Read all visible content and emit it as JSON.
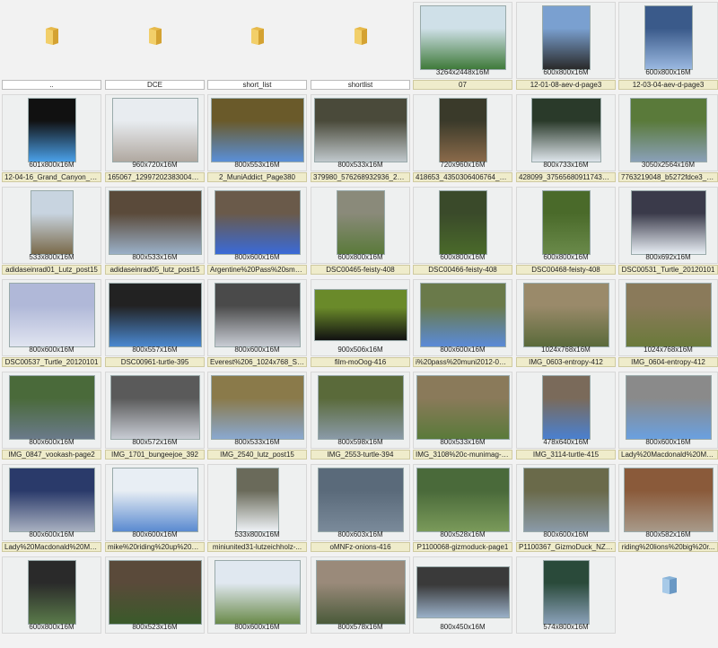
{
  "items": [
    {
      "type": "folder",
      "caption": "..",
      "res": ""
    },
    {
      "type": "folder",
      "caption": "DCE",
      "res": ""
    },
    {
      "type": "folder",
      "caption": "short_list",
      "res": ""
    },
    {
      "type": "folder",
      "caption": "shortlist",
      "res": ""
    },
    {
      "type": "image",
      "caption": "07",
      "res": "3264x2448x16M",
      "tw": 96,
      "th": 72,
      "c1": "#3f7a3a",
      "c2": "#cfe0e8"
    },
    {
      "type": "image",
      "caption": "12-01-08-aev-d-page3",
      "res": "600x800x16M",
      "tw": 54,
      "th": 72,
      "c1": "#2a2a2a",
      "c2": "#7aa0d0"
    },
    {
      "type": "image",
      "caption": "12-03-04-aev-d-page3",
      "res": "600x800x16M",
      "tw": 54,
      "th": 72,
      "c1": "#9ab8e0",
      "c2": "#3a5a8a"
    },
    {
      "type": "image",
      "caption": "12-04-16_Grand_Canyon_A...",
      "res": "601x800x16M",
      "tw": 54,
      "th": 72,
      "c1": "#4aa0e8",
      "c2": "#111111"
    },
    {
      "type": "image",
      "caption": "165067_129972023830043_1...",
      "res": "960x720x16M",
      "tw": 96,
      "th": 72,
      "c1": "#b0a8a0",
      "c2": "#e8ecf0"
    },
    {
      "type": "image",
      "caption": "2_MuniAddict_Page380",
      "res": "800x553x16M",
      "tw": 104,
      "th": 72,
      "c1": "#5a8fd8",
      "c2": "#6a5a2a"
    },
    {
      "type": "image",
      "caption": "379980_576268932936_2655...",
      "res": "800x533x16M",
      "tw": 104,
      "th": 72,
      "c1": "#c0c8cc",
      "c2": "#4a4a3a"
    },
    {
      "type": "image",
      "caption": "418653_4350306406764_211...",
      "res": "720x960x16M",
      "tw": 54,
      "th": 72,
      "c1": "#8a6a4a",
      "c2": "#3a3a2a"
    },
    {
      "type": "image",
      "caption": "428099_375656809117435_1...",
      "res": "800x733x16M",
      "tw": 78,
      "th": 72,
      "c1": "#dde4ea",
      "c2": "#2a3a2a"
    },
    {
      "type": "image",
      "caption": "7763219048_b5272fdce3_o_...",
      "res": "3050x2564x16M",
      "tw": 86,
      "th": 72,
      "c1": "#8aa0b8",
      "c2": "#5a7a3a"
    },
    {
      "type": "image",
      "caption": "adidaseinrad01_Lutz_post15",
      "res": "533x800x16M",
      "tw": 48,
      "th": 72,
      "c1": "#7a6a4a",
      "c2": "#c8d4e0"
    },
    {
      "type": "image",
      "caption": "adidaseinrad05_lutz_post15",
      "res": "800x533x16M",
      "tw": 104,
      "th": 72,
      "c1": "#9ab0c8",
      "c2": "#5a4a3a"
    },
    {
      "type": "image",
      "caption": "Argentine%20Pass%20small...",
      "res": "800x600x16M",
      "tw": 96,
      "th": 72,
      "c1": "#3a6ad8",
      "c2": "#6a5a4a"
    },
    {
      "type": "image",
      "caption": "DSC00465-feisty-408",
      "res": "600x800x16M",
      "tw": 54,
      "th": 72,
      "c1": "#5a7a3a",
      "c2": "#8a8a7a"
    },
    {
      "type": "image",
      "caption": "DSC00466-feisty-408",
      "res": "600x800x16M",
      "tw": 54,
      "th": 72,
      "c1": "#4a6a2a",
      "c2": "#3a4a2a"
    },
    {
      "type": "image",
      "caption": "DSC00468-feisty-408",
      "res": "600x800x16M",
      "tw": 54,
      "th": 72,
      "c1": "#6a8a4a",
      "c2": "#4a6a2a"
    },
    {
      "type": "image",
      "caption": "DSC00531_Turtle_20120101",
      "res": "800x692x16M",
      "tw": 84,
      "th": 72,
      "c1": "#e8eef4",
      "c2": "#3a3a4a"
    },
    {
      "type": "image",
      "caption": "DSC00537_Turtle_20120101",
      "res": "800x600x16M",
      "tw": 96,
      "th": 72,
      "c1": "#e0e4f0",
      "c2": "#b0b8d8"
    },
    {
      "type": "image",
      "caption": "DSC00961-turtle-395",
      "res": "800x557x16M",
      "tw": 104,
      "th": 72,
      "c1": "#4a88d0",
      "c2": "#222222"
    },
    {
      "type": "image",
      "caption": "Everest%206_1024x768_Stev...",
      "res": "800x600x16M",
      "tw": 96,
      "th": 72,
      "c1": "#c8ccd4",
      "c2": "#4a4a4a"
    },
    {
      "type": "image",
      "caption": "film-moOog-416",
      "res": "900x506x16M",
      "tw": 104,
      "th": 58,
      "c1": "#111111",
      "c2": "#6a8a2a"
    },
    {
      "type": "image",
      "caption": "i%20pass%20muni2012-09-...",
      "res": "800x600x16M",
      "tw": 96,
      "th": 72,
      "c1": "#5a8ad8",
      "c2": "#6a7a4a"
    },
    {
      "type": "image",
      "caption": "IMG_0603-entropy-412",
      "res": "1024x768x16M",
      "tw": 96,
      "th": 72,
      "c1": "#5a6a3a",
      "c2": "#9a8a6a"
    },
    {
      "type": "image",
      "caption": "IMG_0604-entropy-412",
      "res": "1024x768x16M",
      "tw": 96,
      "th": 72,
      "c1": "#6a7a3a",
      "c2": "#8a7a5a"
    },
    {
      "type": "image",
      "caption": "IMG_0847_vookash-page2",
      "res": "800x600x16M",
      "tw": 96,
      "th": 72,
      "c1": "#6a7a8a",
      "c2": "#4a6a3a"
    },
    {
      "type": "image",
      "caption": "IMG_1701_bungeejoe_392",
      "res": "800x572x16M",
      "tw": 100,
      "th": 72,
      "c1": "#c8ccd4",
      "c2": "#5a5a5a"
    },
    {
      "type": "image",
      "caption": "IMG_2540_lutz_post15",
      "res": "800x533x16M",
      "tw": 104,
      "th": 72,
      "c1": "#8aa8d0",
      "c2": "#8a7a4a"
    },
    {
      "type": "image",
      "caption": "IMG_2553-turtle-394",
      "res": "800x598x16M",
      "tw": 96,
      "th": 72,
      "c1": "#8a9aa8",
      "c2": "#5a6a3a"
    },
    {
      "type": "image",
      "caption": "IMG_3108%20c-munimag-4...",
      "res": "800x533x16M",
      "tw": 104,
      "th": 72,
      "c1": "#5a7a3a",
      "c2": "#8a7a5a"
    },
    {
      "type": "image",
      "caption": "IMG_3114-turtle-415",
      "res": "478x640x16M",
      "tw": 54,
      "th": 72,
      "c1": "#4a80d0",
      "c2": "#7a6a5a"
    },
    {
      "type": "image",
      "caption": "Lady%20Macdonald%20Mo...",
      "res": "800x600x16M",
      "tw": 96,
      "th": 72,
      "c1": "#6aa0e0",
      "c2": "#8a8a8a"
    },
    {
      "type": "image",
      "caption": "Lady%20Macdonald%20Mo...",
      "res": "800x600x16M",
      "tw": 96,
      "th": 72,
      "c1": "#a8b0c0",
      "c2": "#2a3a6a"
    },
    {
      "type": "image",
      "caption": "mike%20riding%20up%20hi...",
      "res": "800x600x16M",
      "tw": 96,
      "th": 72,
      "c1": "#5a8ad0",
      "c2": "#e8eef4"
    },
    {
      "type": "image",
      "caption": "miniunited31-lutzeichholz-...",
      "res": "533x800x16M",
      "tw": 48,
      "th": 72,
      "c1": "#eef2f6",
      "c2": "#6a6a5a"
    },
    {
      "type": "image",
      "caption": "oMNFz-onions-416",
      "res": "800x603x16M",
      "tw": 96,
      "th": 72,
      "c1": "#7a8a9a",
      "c2": "#5a6a7a"
    },
    {
      "type": "image",
      "caption": "P1100068-gizmoduck-page1",
      "res": "800x528x16M",
      "tw": 104,
      "th": 72,
      "c1": "#7a9a5a",
      "c2": "#4a6a3a"
    },
    {
      "type": "image",
      "caption": "P1100367_GizmoDuck_NZ-t...",
      "res": "800x600x16M",
      "tw": 96,
      "th": 72,
      "c1": "#8a9aa8",
      "c2": "#6a6a4a"
    },
    {
      "type": "image",
      "caption": "riding%20lions%20big%20r...",
      "res": "800x582x16M",
      "tw": 100,
      "th": 72,
      "c1": "#a89a8a",
      "c2": "#8a5a3a"
    },
    {
      "type": "image",
      "caption": "",
      "res": "600x800x16M",
      "tw": 54,
      "th": 72,
      "c1": "#5a7a4a",
      "c2": "#2a2a2a"
    },
    {
      "type": "image",
      "caption": "",
      "res": "800x523x16M",
      "tw": 104,
      "th": 72,
      "c1": "#3a5a2a",
      "c2": "#5a4a3a"
    },
    {
      "type": "image",
      "caption": "",
      "res": "800x600x16M",
      "tw": 96,
      "th": 72,
      "c1": "#6a8a4a",
      "c2": "#e0e8f0"
    },
    {
      "type": "image",
      "caption": "",
      "res": "800x578x16M",
      "tw": 100,
      "th": 72,
      "c1": "#4a5a3a",
      "c2": "#9a8a7a"
    },
    {
      "type": "image",
      "caption": "",
      "res": "800x450x16M",
      "tw": 104,
      "th": 58,
      "c1": "#9ab0c8",
      "c2": "#3a3a3a"
    },
    {
      "type": "image",
      "caption": "",
      "res": "574x800x16M",
      "tw": 52,
      "th": 72,
      "c1": "#8aa0b8",
      "c2": "#2a4a3a"
    },
    {
      "type": "folder",
      "caption": "",
      "res": ""
    }
  ]
}
